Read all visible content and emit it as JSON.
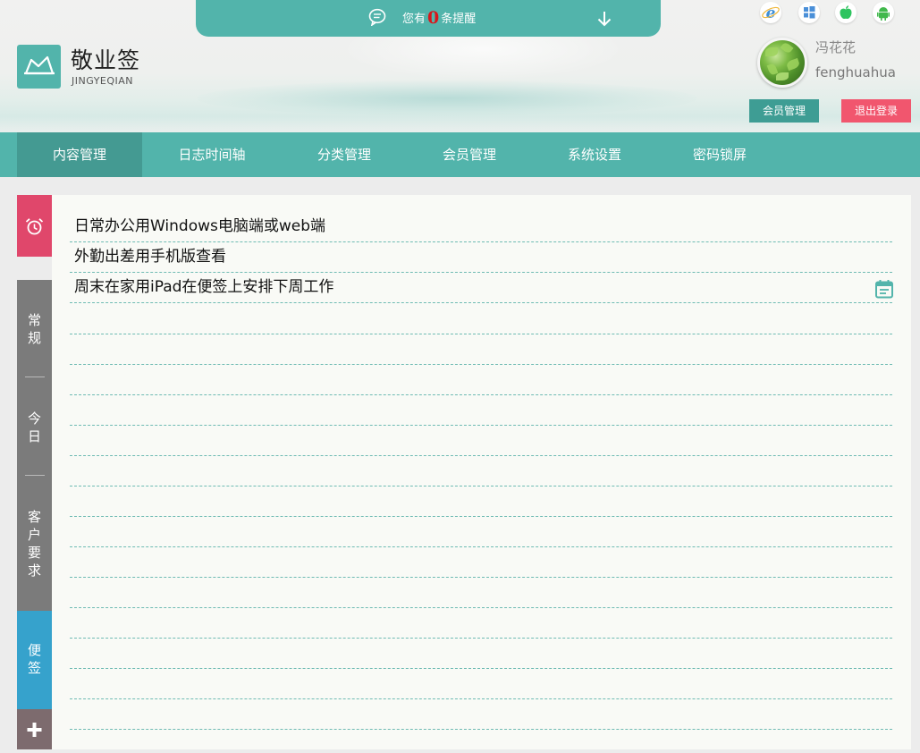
{
  "notice": {
    "prefix": "您有",
    "count": "0",
    "suffix": "条提醒"
  },
  "brand": {
    "name_cn": "敬业签",
    "name_en": "JINGYEQIAN"
  },
  "user": {
    "name_cn": "冯花花",
    "name_en": "fenghuahua"
  },
  "header_buttons": {
    "member": "会员管理",
    "logout": "退出登录"
  },
  "platforms": [
    "ie-icon",
    "windows-icon",
    "apple-icon",
    "android-icon"
  ],
  "nav": [
    "内容管理",
    "日志时间轴",
    "分类管理",
    "会员管理",
    "系统设置",
    "密码锁屏"
  ],
  "side_tabs": {
    "normal": "常规",
    "today": "今日",
    "customer": "客户要求",
    "notes": "便签",
    "add": "+"
  },
  "notes": [
    "日常办公用Windows电脑端或web端",
    "外勤出差用手机版查看",
    "周末在家用iPad在便签上安排下周工作"
  ],
  "colors": {
    "primary": "#52b4ab",
    "logout": "#f1566e",
    "alarm": "#e0476b",
    "notes_tab": "#36a2cc",
    "counter": "#d9161b"
  }
}
